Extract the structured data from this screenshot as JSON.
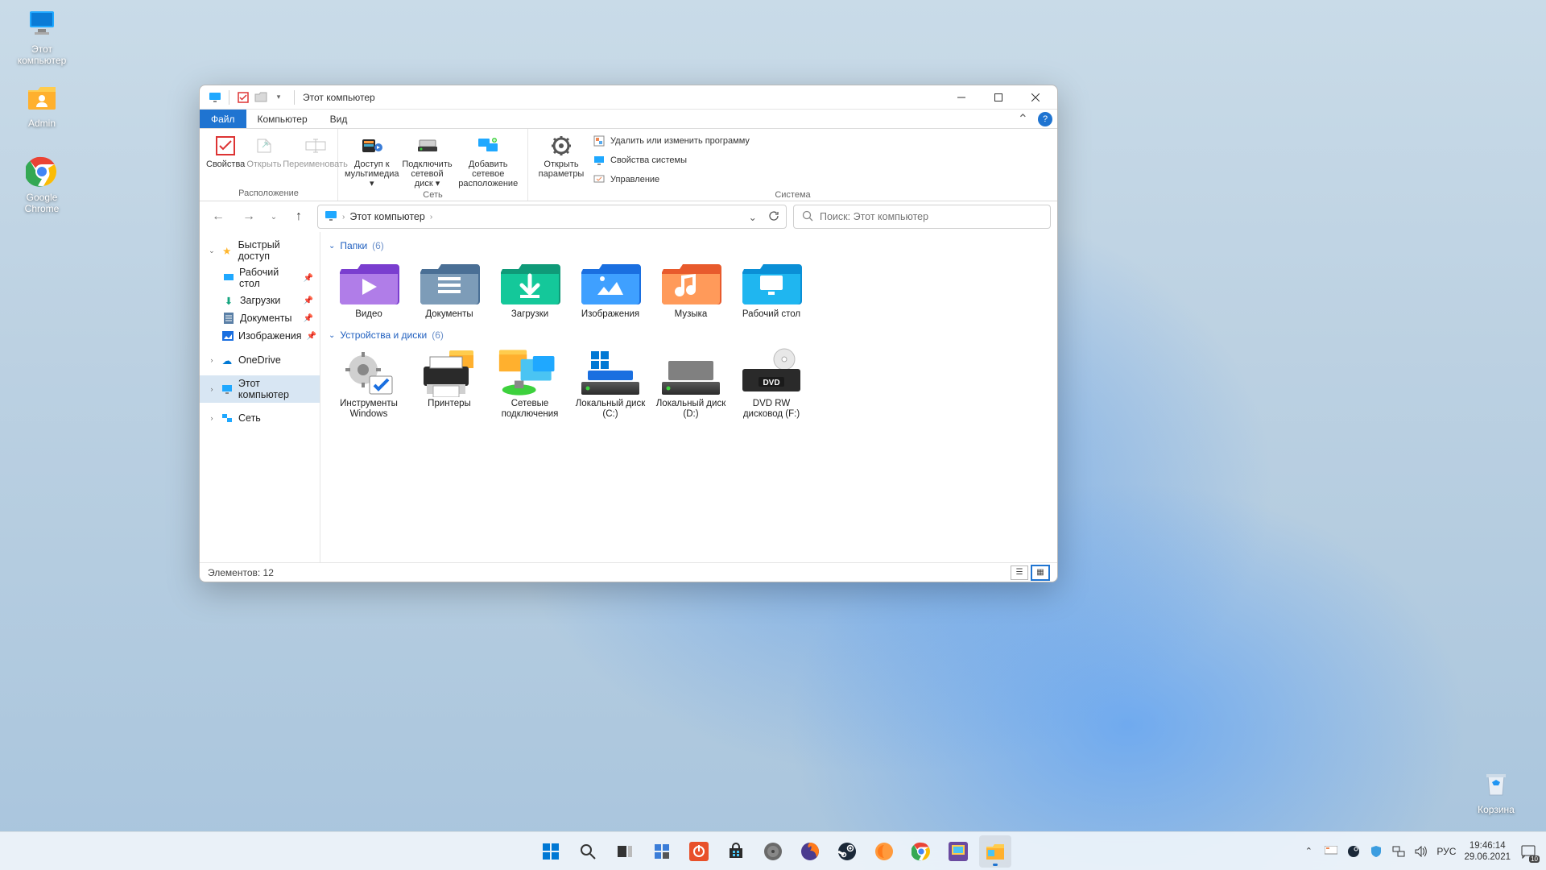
{
  "desktop": {
    "icons": [
      {
        "name": "Этот\nкомпьютер",
        "kind": "pc"
      },
      {
        "name": "Admin",
        "kind": "userfolder"
      },
      {
        "name": "Google\nChrome",
        "kind": "chrome"
      }
    ],
    "recycle": "Корзина"
  },
  "window": {
    "title": "Этот компьютер",
    "tabs": {
      "file": "Файл",
      "computer": "Компьютер",
      "view": "Вид"
    },
    "ribbon": {
      "group_location": "Расположение",
      "group_network": "Сеть",
      "group_system": "Система",
      "btn_properties": "Свойства",
      "btn_open": "Открыть",
      "btn_rename": "Переименовать",
      "btn_media": "Доступ к\nмультимедиа",
      "btn_map": "Подключить\nсетевой диск",
      "btn_addnet": "Добавить сетевое\nрасположение",
      "btn_settings": "Открыть\nпараметры",
      "btn_uninstall": "Удалить или изменить программу",
      "btn_sysprops": "Свойства системы",
      "btn_manage": "Управление"
    },
    "address": {
      "location": "Этот компьютер"
    },
    "search_placeholder": "Поиск: Этот компьютер",
    "sidebar": {
      "quick": "Быстрый доступ",
      "desktop": "Рабочий стол",
      "downloads": "Загрузки",
      "documents": "Документы",
      "pictures": "Изображения",
      "onedrive": "OneDrive",
      "thispc": "Этот компьютер",
      "network": "Сеть"
    },
    "groups": {
      "folders_label": "Папки",
      "folders_count": "(6)",
      "devices_label": "Устройства и диски",
      "devices_count": "(6)"
    },
    "folders": [
      {
        "label": "Видео",
        "color1": "#7a3ecf",
        "color2": "#b07de8",
        "glyph": "play"
      },
      {
        "label": "Документы",
        "color1": "#4a6f95",
        "color2": "#7d9cb8",
        "glyph": "lines"
      },
      {
        "label": "Загрузки",
        "color1": "#0f9a78",
        "color2": "#14c89a",
        "glyph": "down"
      },
      {
        "label": "Изображения",
        "color1": "#1a6fe0",
        "color2": "#3fa0ff",
        "glyph": "image"
      },
      {
        "label": "Музыка",
        "color1": "#e85a2c",
        "color2": "#ff9a5a",
        "glyph": "note"
      },
      {
        "label": "Рабочий стол",
        "color1": "#0a8fd6",
        "color2": "#1fb6f0",
        "glyph": "desk"
      }
    ],
    "devices": [
      {
        "label": "Инструменты\nWindows",
        "kind": "tools"
      },
      {
        "label": "Принтеры",
        "kind": "printer"
      },
      {
        "label": "Сетевые\nподключения",
        "kind": "netconn"
      },
      {
        "label": "Локальный диск\n(C:)",
        "kind": "drive",
        "accent": "#1a6fe0",
        "winlogo": true
      },
      {
        "label": "Локальный диск\n(D:)",
        "kind": "drive",
        "accent": "#808080"
      },
      {
        "label": "DVD RW\nдисковод (F:)",
        "kind": "dvd"
      }
    ],
    "status": "Элементов: 12"
  },
  "taskbar": {
    "tray_lang": "РУС",
    "clock_time": "19:46:14",
    "clock_date": "29.06.2021",
    "notif_count": "10"
  }
}
